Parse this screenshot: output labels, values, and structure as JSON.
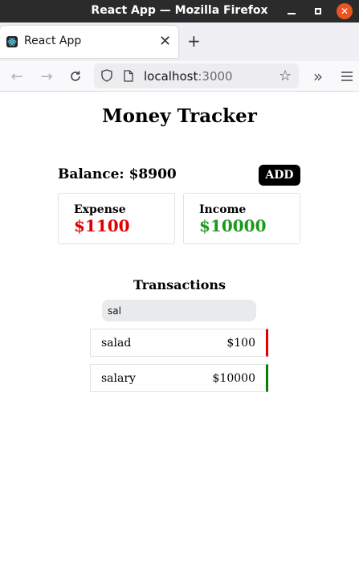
{
  "window": {
    "title": "React App — Mozilla Firefox"
  },
  "browser": {
    "tab_title": "React App",
    "url_host": "localhost",
    "url_port": ":3000"
  },
  "app": {
    "title": "Money Tracker",
    "balance_label": "Balance: $8900",
    "add_label": "ADD",
    "expense": {
      "label": "Expense",
      "amount": "$1100",
      "color": "#e00000"
    },
    "income": {
      "label": "Income",
      "amount": "$10000",
      "color": "#1a9a1a"
    },
    "transactions_heading": "Transactions",
    "search_value": "sal",
    "transactions": [
      {
        "name": "salad",
        "amount": "$100",
        "type": "expense",
        "color": "#e00000"
      },
      {
        "name": "salary",
        "amount": "$10000",
        "type": "income",
        "color": "#0a7a0a"
      }
    ]
  }
}
